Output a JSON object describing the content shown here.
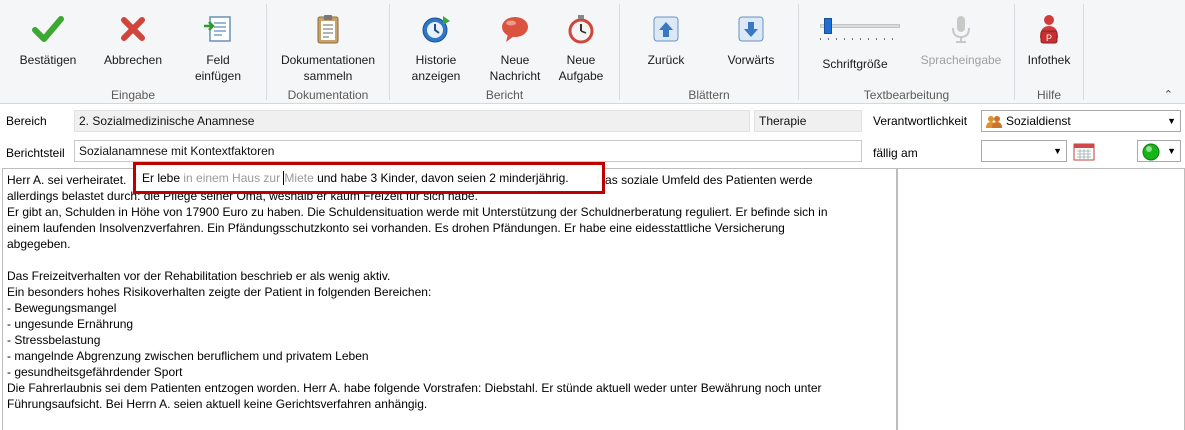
{
  "ribbon": {
    "groups": [
      {
        "label": "Eingabe",
        "buttons": [
          {
            "label": "Bestätigen",
            "icon": "check-icon"
          },
          {
            "label": "Abbrechen",
            "icon": "cross-icon"
          },
          {
            "label": "Feld\neinfügen",
            "icon": "insert-field-icon"
          }
        ]
      },
      {
        "label": "Dokumentation",
        "buttons": [
          {
            "label": "Dokumentationen\nsammeln",
            "icon": "clipboard-icon"
          }
        ]
      },
      {
        "label": "Bericht",
        "buttons": [
          {
            "label": "Historie\nanzeigen",
            "icon": "history-icon"
          },
          {
            "label": "Neue\nNachricht",
            "icon": "message-icon"
          },
          {
            "label": "Neue\nAufgabe",
            "icon": "stopwatch-icon"
          }
        ]
      },
      {
        "label": "Blättern",
        "buttons": [
          {
            "label": "Zurück",
            "icon": "arrow-up-icon"
          },
          {
            "label": "Vorwärts",
            "icon": "arrow-down-icon"
          }
        ]
      },
      {
        "label": "Textbearbeitung",
        "buttons": [
          {
            "label": "Schriftgröße",
            "icon": "slider-icon"
          },
          {
            "label": "Spracheingabe",
            "icon": "microphone-icon"
          }
        ]
      },
      {
        "label": "Hilfe",
        "buttons": [
          {
            "label": "Infothek",
            "icon": "person-info-icon"
          }
        ]
      }
    ],
    "font_size_level": 0.05,
    "collapse_glyph": "⌃"
  },
  "form": {
    "bereich_label": "Bereich",
    "bereich_value": "2. Sozialmedizinische Anamnese",
    "bereich_tag": "Therapie",
    "verantwortlichkeit_label": "Verantwortlichkeit",
    "verantwortlichkeit_value": "Sozialdienst",
    "berichtsteil_label": "Berichtsteil",
    "berichtsteil_value": "Sozialanamnese mit Kontextfaktoren",
    "faellig_label": "fällig am",
    "faellig_value": "",
    "status_color": "#18b418"
  },
  "editor": {
    "lines": [
      "Herr A. sei verheiratet.",
      "allerdings belastet durch: die Pflege seiner Oma, weshalb er kaum Freizeit für sich habe.",
      "Er gibt an, Schulden in Höhe von 17900 Euro zu haben. Die Schuldensituation werde mit Unterstützung der Schuldnerberatung reguliert. Er befinde sich in",
      "einem laufenden Insolvenzverfahren. Ein Pfändungsschutzkonto sei vorhanden. Es drohen Pfändungen. Er habe eine eidesstattliche Versicherung",
      "abgegeben.",
      "",
      "Das Freizeitverhalten vor der Rehabilitation beschrieb er als wenig aktiv.",
      "Ein besonders hohes Risikoverhalten zeigte der Patient in folgenden Bereichen:",
      "- Bewegungsmangel",
      "- ungesunde Ernährung",
      "- Stressbelastung",
      "- mangelnde Abgrenzung zwischen beruflichem und privatem Leben",
      "- gesundheitsgefährdender Sport",
      "Die Fahrerlaubnis sei dem Patienten entzogen worden. Herr A. habe folgende Vorstrafen: Diebstahl. Er stünde aktuell weder unter Bewährung noch unter",
      "Führungsaufsicht. Bei Herrn A. seien aktuell keine Gerichtsverfahren anhängig."
    ],
    "line1_tail": "Das soziale Umfeld des Patienten werde",
    "suggestion": {
      "typed_prefix": "Er lebe ",
      "ghost_text": "in einem Haus zur ",
      "ghost_after_caret": "Miete",
      "typed_suffix": " und habe 3 Kinder, davon seien 2 minderjährig."
    }
  }
}
